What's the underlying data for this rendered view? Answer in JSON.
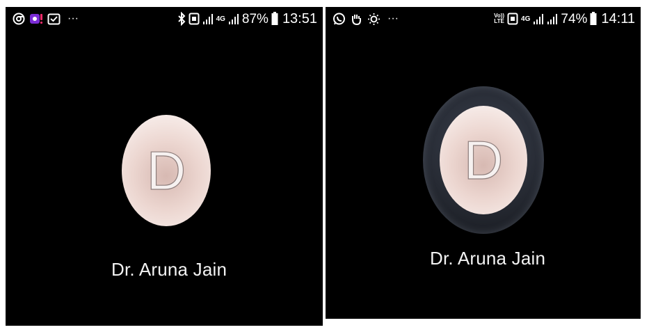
{
  "left_screen": {
    "status_bar": {
      "left_icons": [
        "chrome-icon",
        "notification-app-icon",
        "gmail-icon",
        "more-notifications-icon"
      ],
      "more_label": "···",
      "network_label": "4G",
      "battery_percent": "87%",
      "time": "13:51"
    },
    "avatar_letter": "D",
    "caller_name": "Dr. Aruna Jain"
  },
  "right_screen": {
    "status_bar": {
      "left_icons": [
        "whatsapp-icon",
        "hand-icon",
        "brightness-icon",
        "more-notifications-icon"
      ],
      "more_label": "···",
      "volte_label_top": "Vo))",
      "volte_label_bottom": "LTE",
      "network_label": "4G",
      "battery_percent": "74%",
      "time": "14:11"
    },
    "avatar_letter": "D",
    "caller_name": "Dr. Aruna Jain"
  }
}
